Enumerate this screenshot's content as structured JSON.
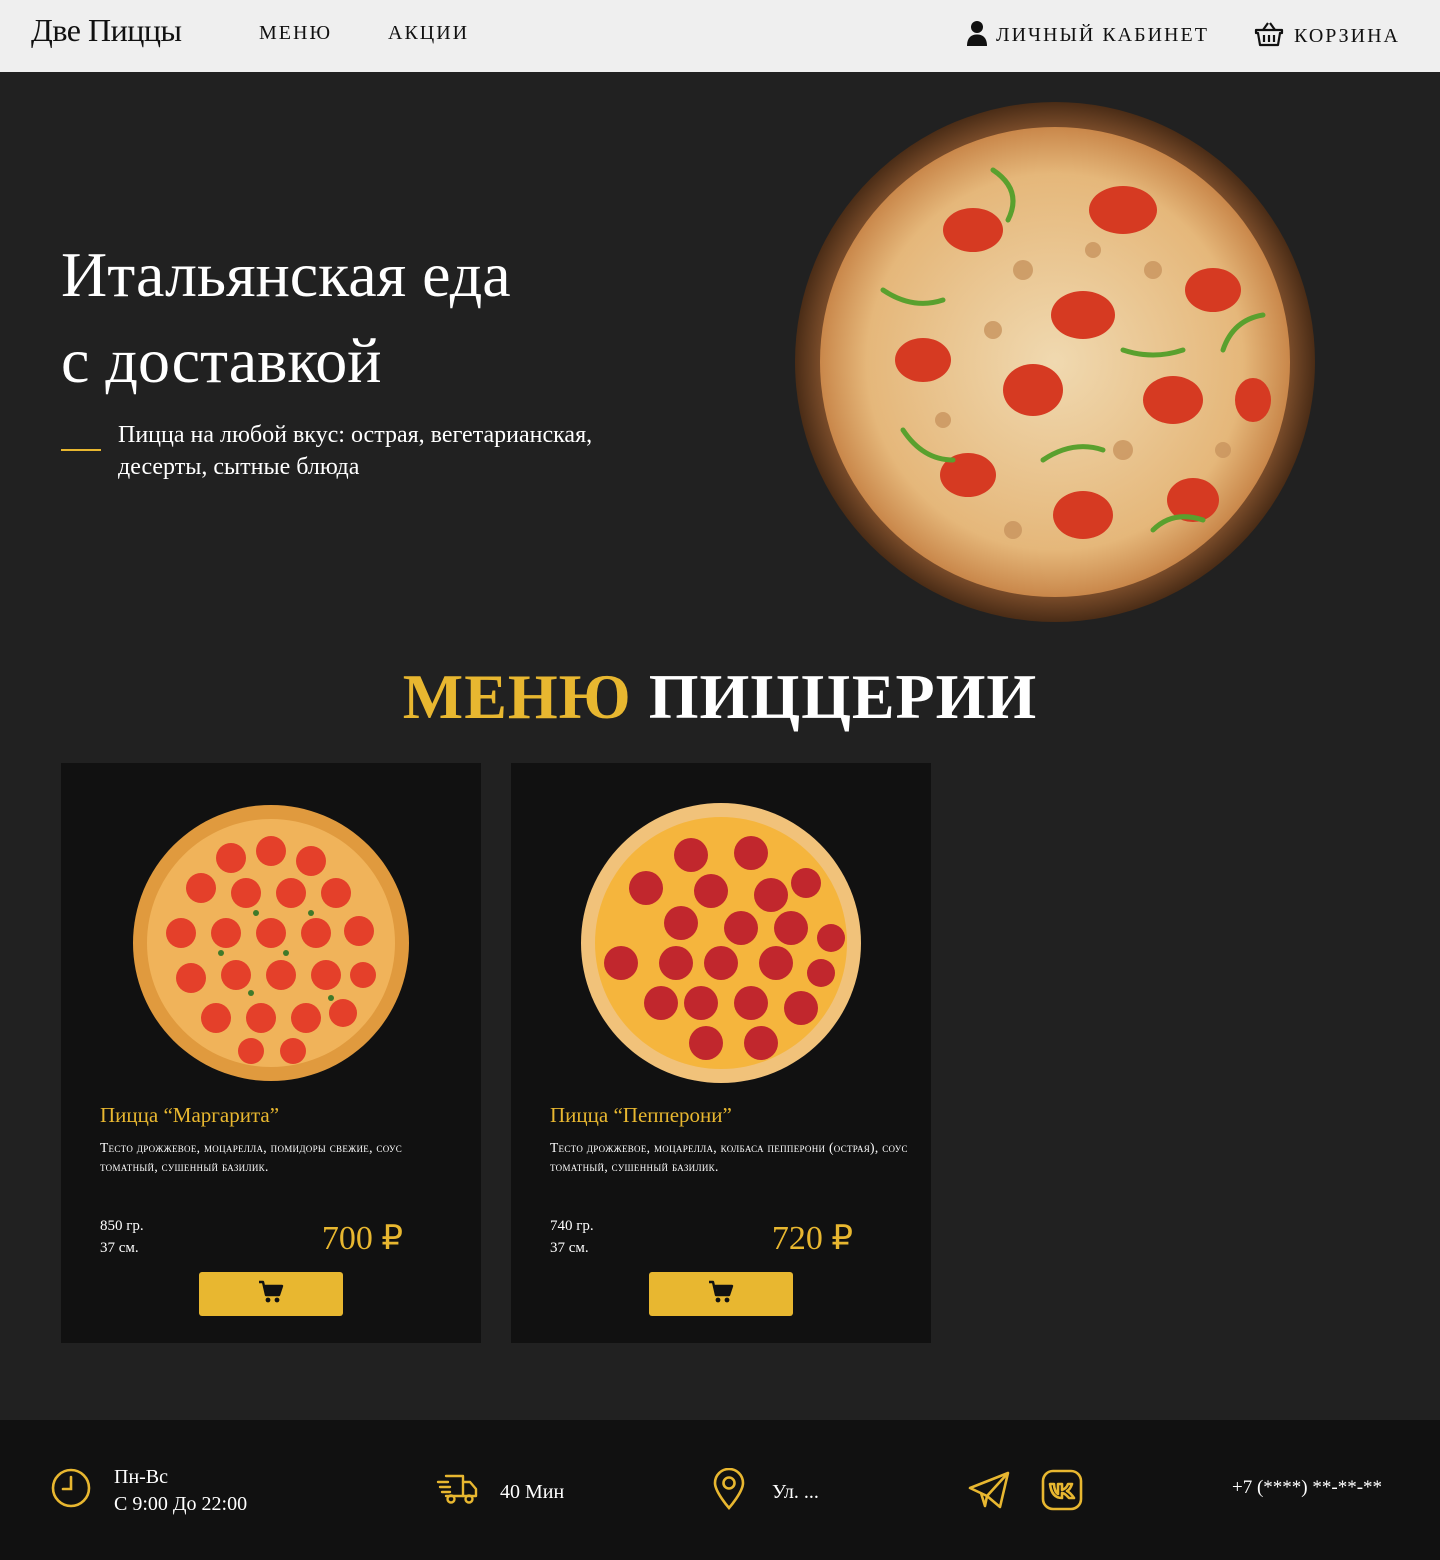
{
  "header": {
    "logo": "Две Пиццы",
    "nav": {
      "menu": "МЕНЮ",
      "promo": "АКЦИИ"
    },
    "account_label": "ЛИЧНЫЙ КАБИНЕТ",
    "cart_label": "КОРЗИНА"
  },
  "hero": {
    "title_line1": "Итальянская еда",
    "title_line2": "с доставкой",
    "subtitle": "Пицца на любой вкус: острая, вегетарианская, десерты, сытные блюда"
  },
  "menu": {
    "title_accent": "МЕНЮ",
    "title_rest": "ПИЦЦЕРИИ",
    "items": [
      {
        "name": "Пицца “Маргарита”",
        "description": "Тесто дрожжевое, моцарелла, помидоры свежие, соус томатный, сушенный базилик.",
        "weight": "850 гр.",
        "size": "37 см.",
        "price": "700 ₽"
      },
      {
        "name": "Пицца “Пепперони”",
        "description": "Тесто дрожжевое, моцарелла, колбаса пепперони (острая), соус томатный, сушенный базилик.",
        "weight": "740 гр.",
        "size": "37 см.",
        "price": "720 ₽"
      }
    ]
  },
  "footer": {
    "hours_days": "Пн-Вс",
    "hours_time": "С 9:00 До 22:00",
    "delivery_time": "40 Мин",
    "address": "Ул. ...",
    "phone": "+7 (****) **-**-**"
  },
  "colors": {
    "accent": "#e8b730",
    "background": "#212121",
    "card": "#111111",
    "header": "#efefef"
  },
  "icons": [
    "user-icon",
    "basket-icon",
    "cart-icon",
    "clock-icon",
    "truck-icon",
    "location-pin-icon",
    "telegram-icon",
    "vk-icon"
  ]
}
